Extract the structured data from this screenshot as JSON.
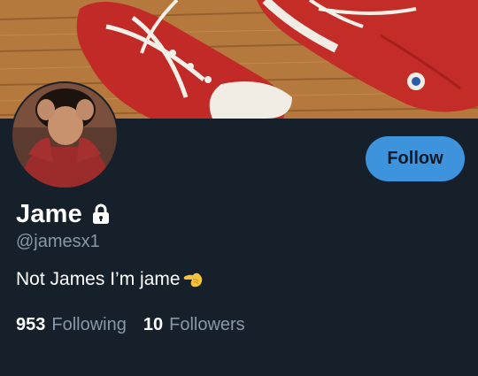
{
  "profile": {
    "display_name": "Jame",
    "handle": "@jamesx1",
    "bio": "Not James I’m jame",
    "bio_emoji": "pointing-left-emoji",
    "protected_icon": "lock-icon",
    "avatar_icon": "avatar-photo",
    "banner_icon": "red-sneakers-banner"
  },
  "actions": {
    "follow_label": "Follow"
  },
  "stats": {
    "following_count": "953",
    "following_label": "Following",
    "followers_count": "10",
    "followers_label": "Followers"
  },
  "colors": {
    "background": "#15202b",
    "accent": "#3d94dd",
    "secondary_text": "#8899a6"
  }
}
